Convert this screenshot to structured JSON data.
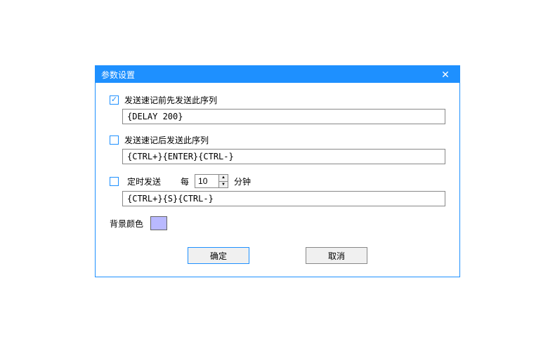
{
  "dialog": {
    "title": "参数设置"
  },
  "opt1": {
    "label": "发送速记前先发送此序列",
    "checked": true,
    "value": "{DELAY 200}"
  },
  "opt2": {
    "label": "发送速记后发送此序列",
    "checked": false,
    "value": "{CTRL+}{ENTER}{CTRL-}"
  },
  "opt3": {
    "label": "定时发送",
    "checked": false,
    "every_label": "每",
    "interval": "10",
    "unit_label": "分钟",
    "value": "{CTRL+}{S}{CTRL-}"
  },
  "bgcolor": {
    "label": "背景颜色",
    "value": "#b9b9ff"
  },
  "buttons": {
    "ok": "确定",
    "cancel": "取消"
  }
}
